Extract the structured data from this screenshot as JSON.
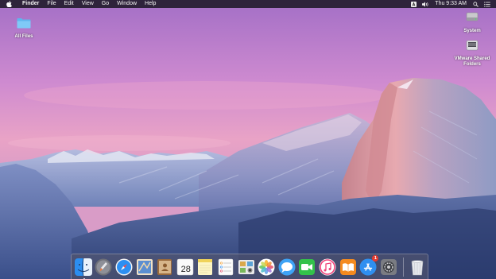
{
  "menubar": {
    "apple_icon": "apple-icon",
    "items": [
      "Finder",
      "File",
      "Edit",
      "View",
      "Go",
      "Window",
      "Help"
    ],
    "status_icons": [
      "input-source-icon",
      "volume-icon"
    ],
    "clock": "Thu 9:33 AM",
    "right_icons": [
      "spotlight-icon",
      "notification-center-icon"
    ]
  },
  "desktop": {
    "icons": [
      {
        "label": "All Files",
        "icon": "folder-icon"
      },
      {
        "label": "System",
        "icon": "hard-drive-icon"
      },
      {
        "label": "VMware Shared Folders",
        "icon": "shared-folders-icon"
      }
    ]
  },
  "dock": {
    "apps": [
      {
        "name": "finder",
        "icon": "finder-icon",
        "running": true
      },
      {
        "name": "launchpad",
        "icon": "launchpad-icon"
      },
      {
        "name": "safari",
        "icon": "safari-icon"
      },
      {
        "name": "mail",
        "icon": "mail-icon"
      },
      {
        "name": "contacts",
        "icon": "contacts-icon"
      },
      {
        "name": "calendar",
        "icon": "calendar-icon",
        "day": "28"
      },
      {
        "name": "notes",
        "icon": "notes-icon"
      },
      {
        "name": "reminders",
        "icon": "reminders-icon"
      },
      {
        "name": "photo-booth",
        "icon": "photo-booth-icon"
      },
      {
        "name": "photos",
        "icon": "photos-icon"
      },
      {
        "name": "messages",
        "icon": "messages-icon"
      },
      {
        "name": "facetime",
        "icon": "facetime-icon"
      },
      {
        "name": "itunes",
        "icon": "itunes-icon"
      },
      {
        "name": "ibooks",
        "icon": "ibooks-icon"
      },
      {
        "name": "app-store",
        "icon": "app-store-icon",
        "badge": "1"
      },
      {
        "name": "system-preferences",
        "icon": "system-preferences-icon"
      }
    ],
    "trash": {
      "name": "trash",
      "icon": "trash-icon"
    }
  },
  "colors": {
    "menubar_bg": "#16141c",
    "badge": "#e53b30",
    "sky_top": "#a774c8",
    "sky_mid": "#e7a2bf"
  }
}
